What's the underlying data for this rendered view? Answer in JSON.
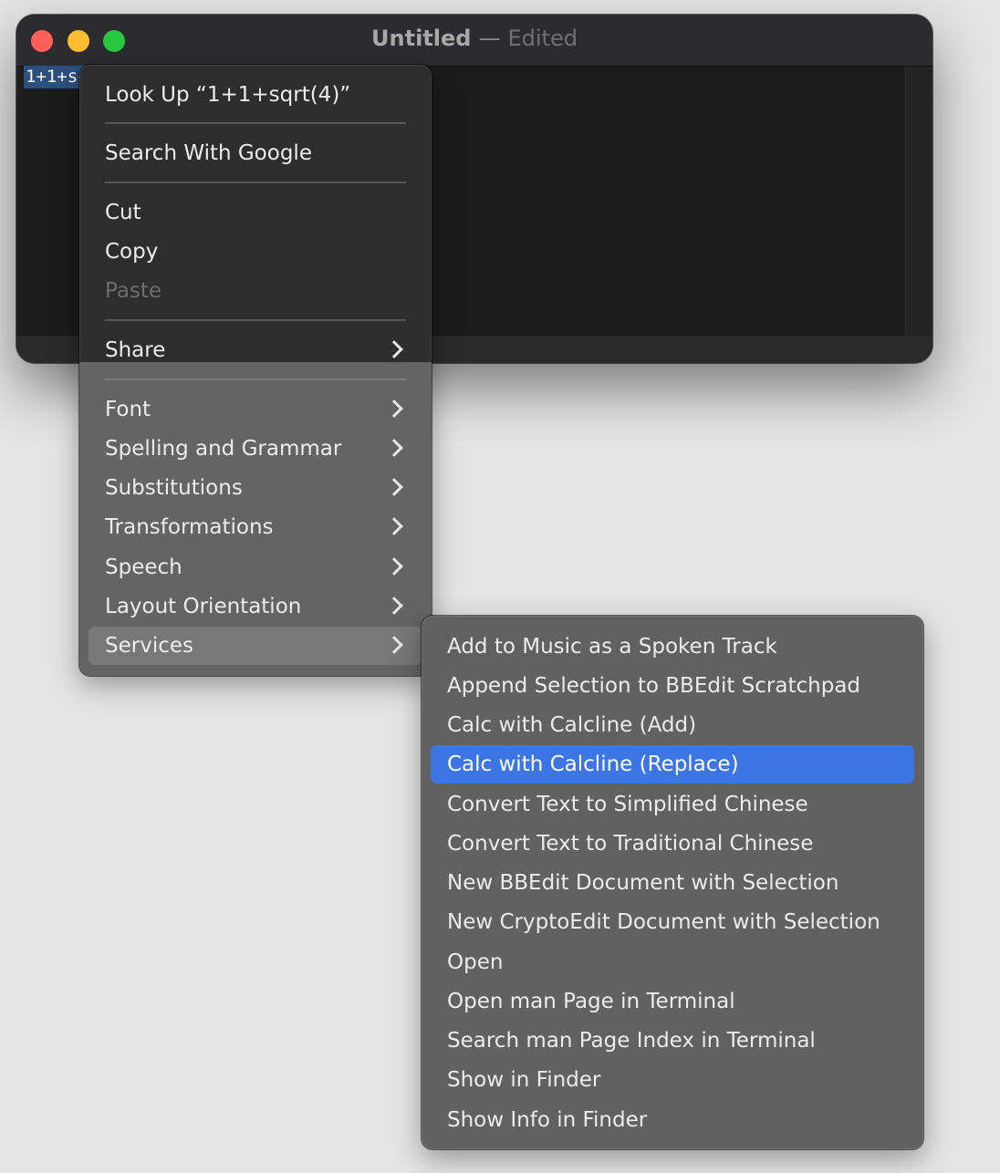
{
  "window": {
    "title": "Untitled",
    "separator": "—",
    "status": "Edited",
    "selected_text": "1+1+sqrt(4)",
    "colors": {
      "close": "#ff5f57",
      "minimize": "#febc2e",
      "zoom": "#28c840"
    }
  },
  "context_menu": {
    "look_up": "Look Up “1+1+sqrt(4)”",
    "search_google": "Search With Google",
    "cut": "Cut",
    "copy": "Copy",
    "paste": "Paste",
    "share": "Share",
    "font": "Font",
    "spelling_grammar": "Spelling and Grammar",
    "substitutions": "Substitutions",
    "transformations": "Transformations",
    "speech": "Speech",
    "layout_orientation": "Layout Orientation",
    "services": "Services"
  },
  "services_menu": {
    "items": [
      "Add to Music as a Spoken Track",
      "Append Selection to BBEdit Scratchpad",
      "Calc with Calcline (Add)",
      "Calc with Calcline (Replace)",
      "Convert Text to Simplified Chinese",
      "Convert Text to Traditional Chinese",
      "New BBEdit Document with Selection",
      "New CryptoEdit Document with Selection",
      "Open",
      "Open man Page in Terminal",
      "Search man Page Index in Terminal",
      "Show in Finder",
      "Show Info in Finder"
    ],
    "highlight_color": "#3b76e4"
  }
}
